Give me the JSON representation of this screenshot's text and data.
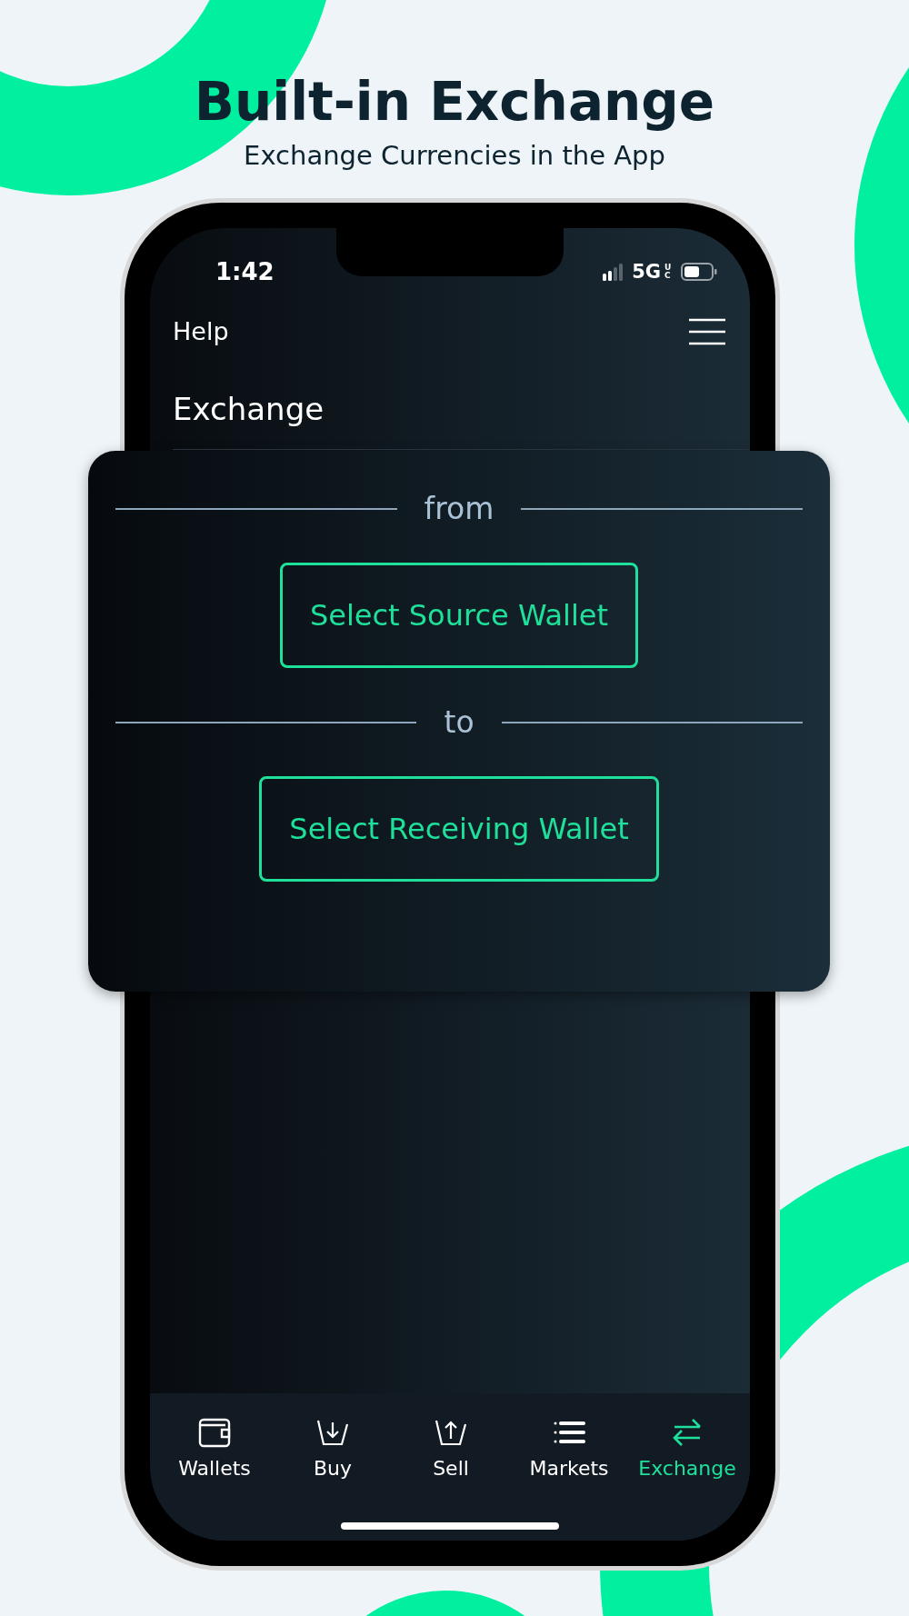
{
  "headline": "Built-in Exchange",
  "subheadline": "Exchange Currencies in the App",
  "status_bar": {
    "time": "1:42",
    "network": "5G",
    "network_suffix": "UC"
  },
  "header": {
    "help_link": "Help",
    "title": "Exchange"
  },
  "exchange_card": {
    "sections": [
      {
        "divider_label": "from",
        "button": "Select Source Wallet"
      },
      {
        "divider_label": "to",
        "button": "Select Receiving Wallet"
      }
    ]
  },
  "tab_bar": [
    {
      "label": "Wallets",
      "kind": "wallet",
      "selected": false
    },
    {
      "label": "Buy",
      "kind": "buy",
      "selected": false
    },
    {
      "label": "Sell",
      "kind": "sell",
      "selected": false
    },
    {
      "label": "Markets",
      "kind": "markets",
      "selected": false
    },
    {
      "label": "Exchange",
      "kind": "exchange",
      "selected": true
    }
  ]
}
